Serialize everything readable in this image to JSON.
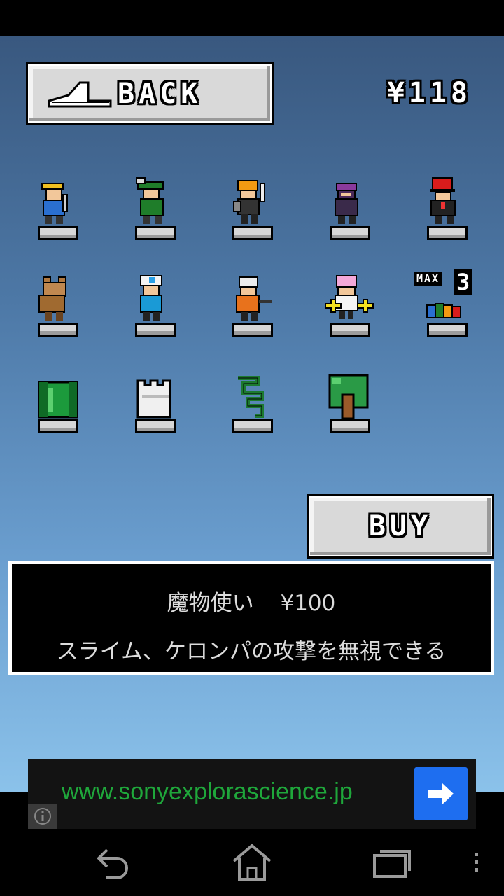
{
  "header": {
    "back_label": "BACK",
    "money": "¥118",
    "buy_label": "BUY"
  },
  "shop": {
    "rows": [
      [
        "yellow-hat-hero",
        "green-archer",
        "orange-helmet-knight",
        "purple-ninja",
        "red-tophat-gentleman"
      ],
      [
        "brown-beast",
        "white-cap-nurse",
        "white-hair-fighter",
        "pink-hair-girl",
        "max-party-upgrade"
      ],
      [
        "green-pipe",
        "white-castle-block",
        "green-vine",
        "green-tree"
      ]
    ],
    "max_tag": "MAX",
    "max_count": "3"
  },
  "info": {
    "item_name": "魔物使い",
    "item_price": "¥100",
    "description": "スライム、ケロンパの攻撃を無視できる"
  },
  "ad": {
    "url": "www.sonyexplorascience.jp"
  },
  "colors": {
    "ad_text": "#1fa73b",
    "ad_button": "#1e6ef0"
  }
}
